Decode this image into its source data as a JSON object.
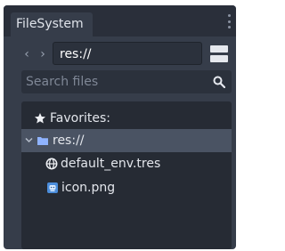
{
  "dock": {
    "tab_label": "FileSystem",
    "tab_menu_icon": "vertical-ellipsis-icon"
  },
  "navigation": {
    "back_label": "‹",
    "forward_label": "›",
    "path": "res://",
    "split_mode_icon": "split-view-icon"
  },
  "search": {
    "placeholder": "Search files",
    "icon": "magnifier-icon"
  },
  "tree": {
    "items": [
      {
        "label": "Favorites:",
        "icon": "star-icon"
      },
      {
        "label": "res://",
        "icon": "folder-icon",
        "expanded": true,
        "selected": true
      },
      {
        "label": "default_env.tres",
        "icon": "globe-icon"
      },
      {
        "label": "icon.png",
        "icon": "image-icon"
      }
    ]
  },
  "colors": {
    "panel_bg": "#363d4a",
    "tree_bg": "#262b34",
    "selected_row": "#4a5363",
    "folder": "#8fb3ff"
  }
}
